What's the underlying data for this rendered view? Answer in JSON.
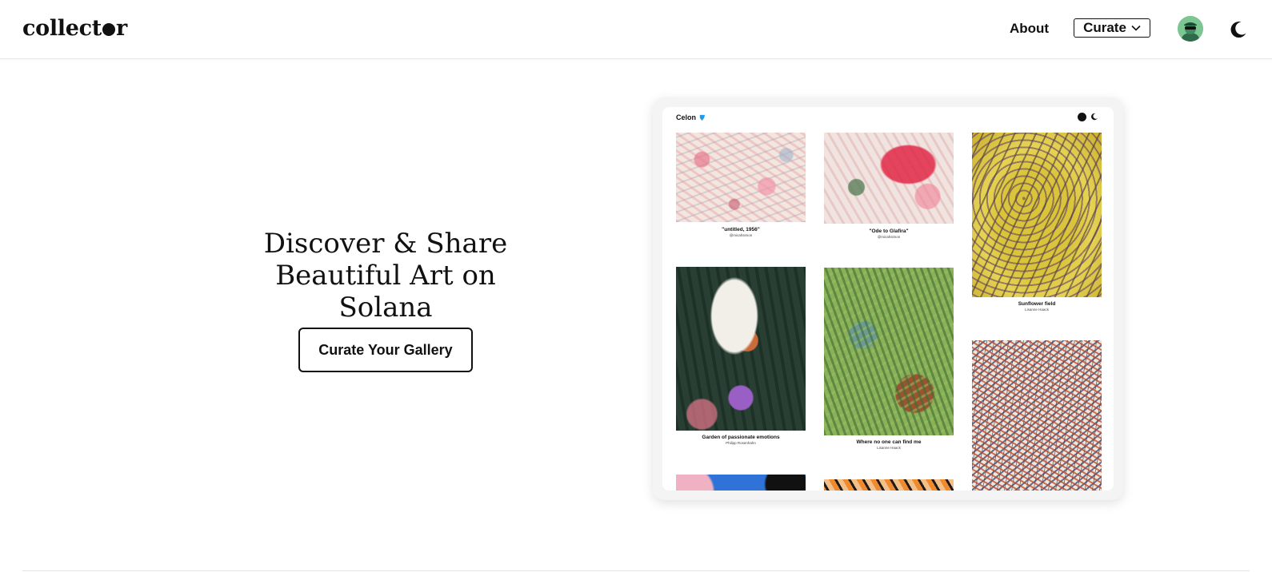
{
  "header": {
    "logo_text_before": "collect",
    "logo_text_after": "r",
    "nav": {
      "about_label": "About",
      "curate_label": "Curate"
    }
  },
  "hero": {
    "title_line1": "Discover & Share",
    "title_line2": "Beautiful Art on Solana",
    "cta_label": "Curate Your Gallery"
  },
  "preview": {
    "username": "Celon",
    "artworks": [
      {
        "title": "\"untitled, 1956\"",
        "artist": "@micahsimon"
      },
      {
        "title": "\"Ode to Glafira\"",
        "artist": "@micahsimon"
      },
      {
        "title": "Sunflower field",
        "artist": "Lisanne Haack"
      },
      {
        "title": "Garden of passionate emotions",
        "artist": "Philipp Rosenhahn"
      },
      {
        "title": "Where no one can find me",
        "artist": "Lisanne Haack"
      },
      {
        "title": "",
        "artist": ""
      },
      {
        "title": "",
        "artist": ""
      },
      {
        "title": "",
        "artist": ""
      }
    ]
  },
  "icons": {
    "verified": "verified-badge-icon",
    "theme": "moon-icon",
    "dropdown": "chevron-down-icon"
  },
  "colors": {
    "accent": "#111111",
    "verified_blue": "#1d9bf0",
    "avatar_bg": "#7bc692"
  }
}
